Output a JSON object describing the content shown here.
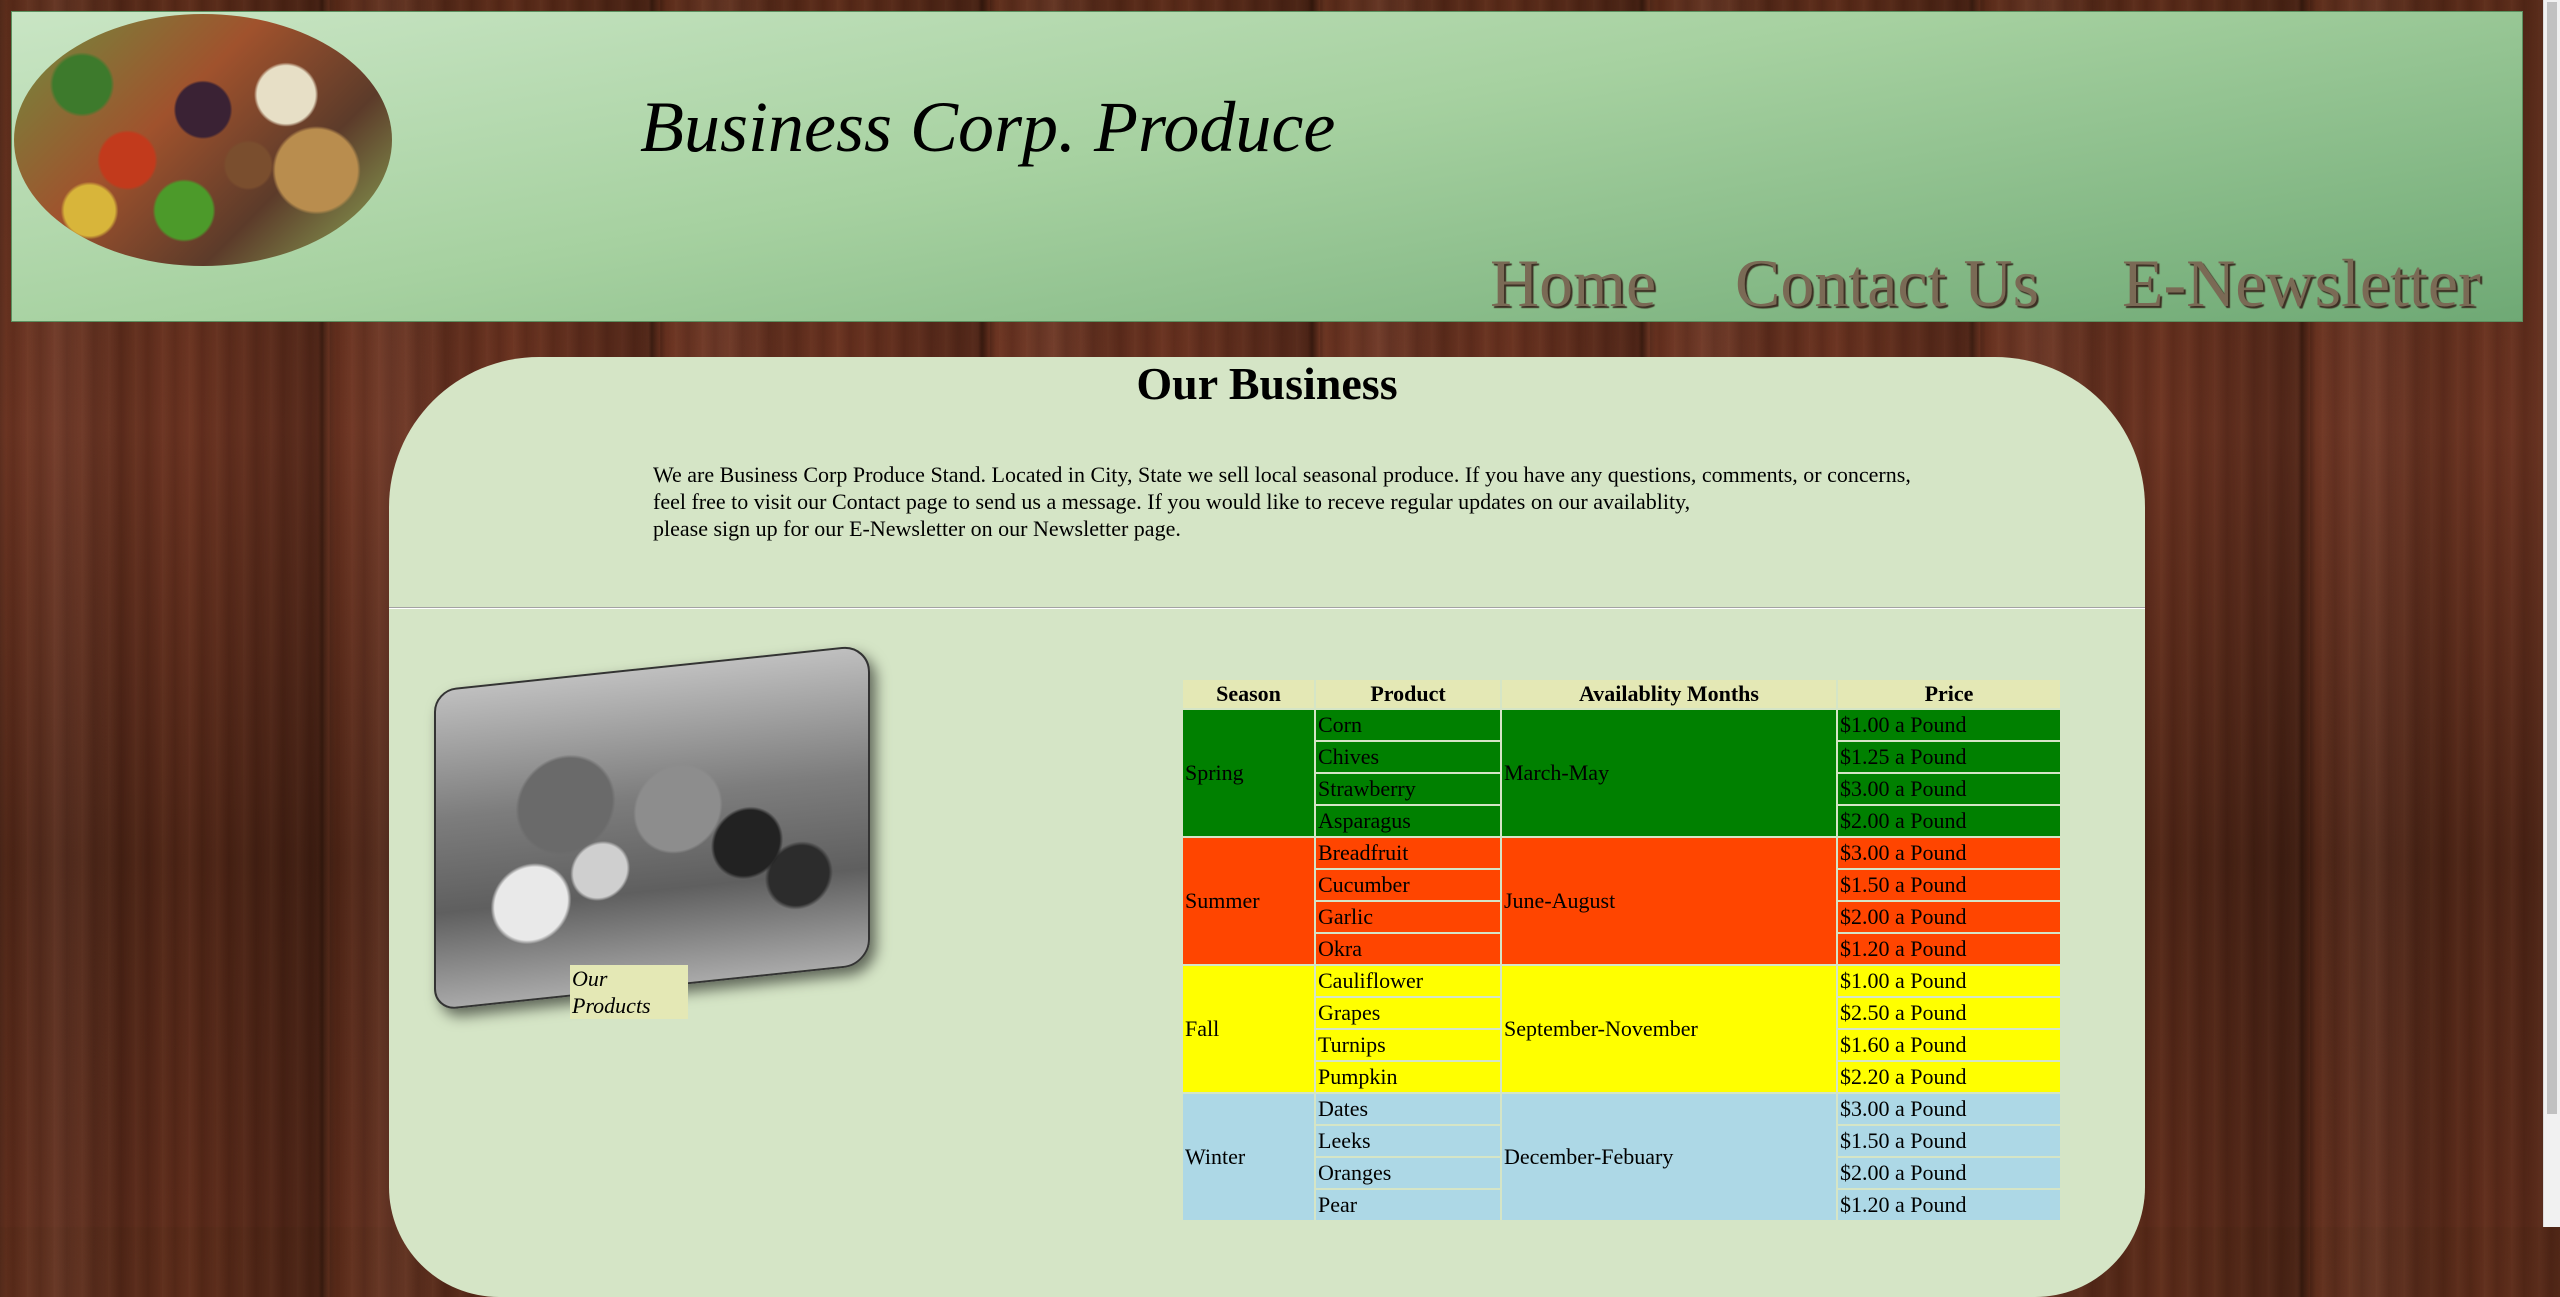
{
  "header": {
    "logo_alt": "produce market crates",
    "title": "Business Corp. Produce",
    "nav": [
      {
        "label": "Home"
      },
      {
        "label": "Contact Us"
      },
      {
        "label": "E-Newsletter"
      }
    ]
  },
  "main": {
    "heading": "Our Business",
    "intro_lines": [
      "We are Business Corp Produce Stand. Located in City, State we sell local seasonal produce. If you have any questions, comments, or concerns,",
      "feel free to visit our Contact page to send us a message. If you would like to receve regular updates on our availablity,",
      "please sign up for our E-Newsletter on our Newsletter page."
    ],
    "photo_caption": "Our Products"
  },
  "table": {
    "headers": {
      "season": "Season",
      "product": "Product",
      "months": "Availablity Months",
      "price": "Price"
    },
    "seasons": [
      {
        "name": "Spring",
        "months": "March-May",
        "color": "#008000",
        "items": [
          {
            "product": "Corn",
            "price": "$1.00 a Pound"
          },
          {
            "product": "Chives",
            "price": "$1.25 a Pound"
          },
          {
            "product": "Strawberry",
            "price": "$3.00 a Pound"
          },
          {
            "product": "Asparagus",
            "price": "$2.00 a Pound"
          }
        ]
      },
      {
        "name": "Summer",
        "months": "June-August",
        "color": "#ff4500",
        "items": [
          {
            "product": "Breadfruit",
            "price": "$3.00 a Pound"
          },
          {
            "product": "Cucumber",
            "price": "$1.50 a Pound"
          },
          {
            "product": "Garlic",
            "price": "$2.00 a Pound"
          },
          {
            "product": "Okra",
            "price": "$1.20 a Pound"
          }
        ]
      },
      {
        "name": "Fall",
        "months": "September-November",
        "color": "#ffff00",
        "items": [
          {
            "product": "Cauliflower",
            "price": "$1.00 a Pound"
          },
          {
            "product": "Grapes",
            "price": "$2.50 a Pound"
          },
          {
            "product": "Turnips",
            "price": "$1.60 a Pound"
          },
          {
            "product": "Pumpkin",
            "price": "$2.20 a Pound"
          }
        ]
      },
      {
        "name": "Winter",
        "months": "December-Febuary",
        "color": "#add8e6",
        "items": [
          {
            "product": "Dates",
            "price": "$3.00 a Pound"
          },
          {
            "product": "Leeks",
            "price": "$1.50 a Pound"
          },
          {
            "product": "Oranges",
            "price": "$2.00 a Pound"
          },
          {
            "product": "Pear",
            "price": "$1.20 a Pound"
          }
        ]
      }
    ]
  },
  "colors": {
    "header_green": "#a6d1a0",
    "content_bg": "#d5e5c6",
    "table_header_bg": "#e4e8b5",
    "wood": "#5a2a18"
  }
}
